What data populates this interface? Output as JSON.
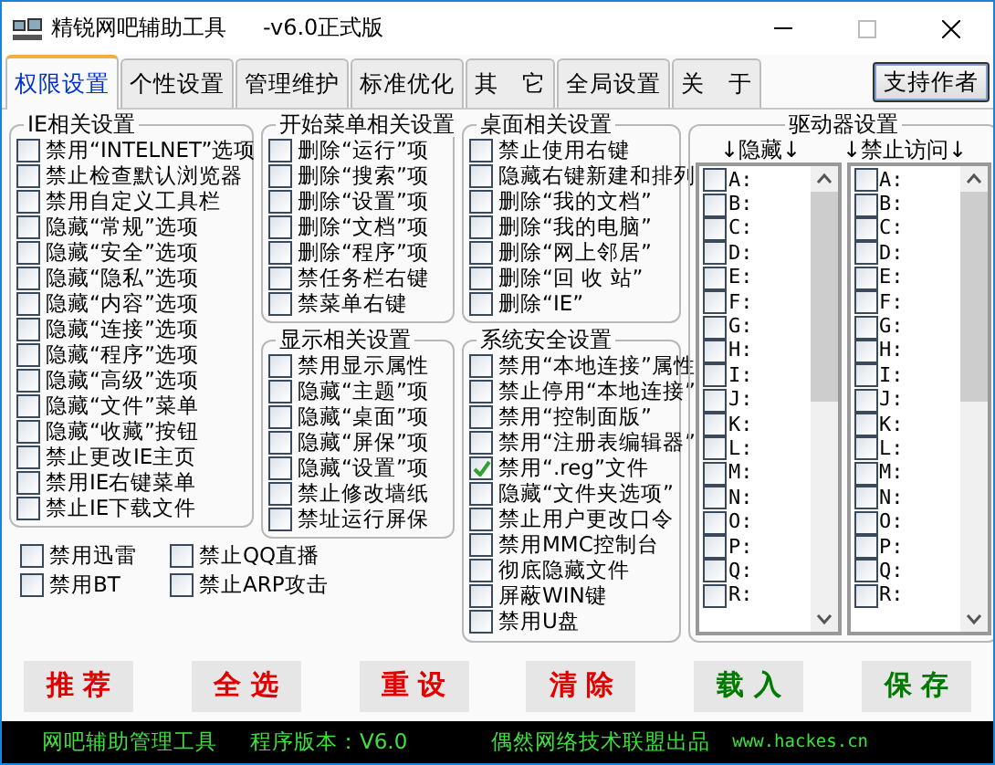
{
  "window": {
    "title": "精锐网吧辅助工具",
    "version": "-v6.0正式版"
  },
  "tabs": [
    {
      "label": "权限设置",
      "selected": true
    },
    {
      "label": "个性设置",
      "selected": false
    },
    {
      "label": "管理维护",
      "selected": false
    },
    {
      "label": "标准优化",
      "selected": false
    },
    {
      "label": "其　它",
      "selected": false
    },
    {
      "label": "全局设置",
      "selected": false
    },
    {
      "label": "关　于",
      "selected": false
    }
  ],
  "support_button": "支持作者",
  "ie_settings": {
    "title": "IE相关设置",
    "items": [
      {
        "label": "禁用“INTELNET”选项",
        "checked": false
      },
      {
        "label": "禁止检查默认浏览器",
        "checked": false
      },
      {
        "label": "禁用自定义工具栏",
        "checked": false
      },
      {
        "label": "隐藏“常规”选项",
        "checked": false
      },
      {
        "label": "隐藏“安全”选项",
        "checked": false
      },
      {
        "label": "隐藏“隐私”选项",
        "checked": false
      },
      {
        "label": "隐藏“内容”选项",
        "checked": false
      },
      {
        "label": "隐藏“连接”选项",
        "checked": false
      },
      {
        "label": "隐藏“程序”选项",
        "checked": false
      },
      {
        "label": "隐藏“高级”选项",
        "checked": false
      },
      {
        "label": "隐藏“文件”菜单",
        "checked": false
      },
      {
        "label": "隐藏“收藏”按钮",
        "checked": false
      },
      {
        "label": "禁止更改IE主页",
        "checked": false
      },
      {
        "label": "禁用IE右键菜单",
        "checked": false
      },
      {
        "label": "禁止IE下载文件",
        "checked": false
      }
    ]
  },
  "extra_options": [
    {
      "label": "禁用迅雷",
      "checked": false
    },
    {
      "label": "禁止QQ直播",
      "checked": false
    },
    {
      "label": "禁用BT",
      "checked": false
    },
    {
      "label": "禁止ARP攻击",
      "checked": false
    }
  ],
  "start_menu_settings": {
    "title": "开始菜单相关设置",
    "items": [
      {
        "label": "删除“运行”项",
        "checked": false
      },
      {
        "label": "删除“搜索”项",
        "checked": false
      },
      {
        "label": "删除“设置”项",
        "checked": false
      },
      {
        "label": "删除“文档”项",
        "checked": false
      },
      {
        "label": "删除“程序”项",
        "checked": false
      },
      {
        "label": "禁任务栏右键",
        "checked": false
      },
      {
        "label": "禁菜单右键",
        "checked": false
      }
    ]
  },
  "display_settings": {
    "title": "显示相关设置",
    "items": [
      {
        "label": "禁用显示属性",
        "checked": false
      },
      {
        "label": "隐藏“主题”项",
        "checked": false
      },
      {
        "label": "隐藏“桌面”项",
        "checked": false
      },
      {
        "label": "隐藏“屏保”项",
        "checked": false
      },
      {
        "label": "隐藏“设置”项",
        "checked": false
      },
      {
        "label": "禁止修改墙纸",
        "checked": false
      },
      {
        "label": "禁址运行屏保",
        "checked": false
      }
    ]
  },
  "desktop_settings": {
    "title": "桌面相关设置",
    "items": [
      {
        "label": "禁止使用右键",
        "checked": false
      },
      {
        "label": "隐藏右键新建和排列",
        "checked": false
      },
      {
        "label": "删除“我的文档”",
        "checked": false
      },
      {
        "label": "删除“我的电脑”",
        "checked": false
      },
      {
        "label": "删除“网上邻居”",
        "checked": false
      },
      {
        "label": "删除“回 收 站”",
        "checked": false
      },
      {
        "label": "删除“IE”",
        "checked": false
      }
    ]
  },
  "security_settings": {
    "title": "系统安全设置",
    "items": [
      {
        "label": "禁用“本地连接”属性",
        "checked": false
      },
      {
        "label": "禁止停用“本地连接”",
        "checked": false
      },
      {
        "label": "禁用“控制面版”",
        "checked": false
      },
      {
        "label": "禁用“注册表编辑器”",
        "checked": false
      },
      {
        "label": "禁用“.reg”文件",
        "checked": true
      },
      {
        "label": "隐藏“文件夹选项”",
        "checked": false
      },
      {
        "label": "禁止用户更改口令",
        "checked": false
      },
      {
        "label": "禁用MMC控制台",
        "checked": false
      },
      {
        "label": "彻底隐藏文件",
        "checked": false
      },
      {
        "label": "屏蔽WIN键",
        "checked": false
      },
      {
        "label": "禁用U盘",
        "checked": false
      }
    ]
  },
  "drive_settings": {
    "title": "驱动器设置",
    "hide_header": "↓隐藏↓",
    "deny_header": "↓禁止访问↓",
    "hide_drives": [
      {
        "label": "A:",
        "checked": false
      },
      {
        "label": "B:",
        "checked": false
      },
      {
        "label": "C:",
        "checked": false
      },
      {
        "label": "D:",
        "checked": false
      },
      {
        "label": "E:",
        "checked": false
      },
      {
        "label": "F:",
        "checked": false
      },
      {
        "label": "G:",
        "checked": false
      },
      {
        "label": "H:",
        "checked": false
      },
      {
        "label": "I:",
        "checked": false
      },
      {
        "label": "J:",
        "checked": false
      },
      {
        "label": "K:",
        "checked": false
      },
      {
        "label": "L:",
        "checked": false
      },
      {
        "label": "M:",
        "checked": false
      },
      {
        "label": "N:",
        "checked": false
      },
      {
        "label": "O:",
        "checked": false
      },
      {
        "label": "P:",
        "checked": false
      },
      {
        "label": "Q:",
        "checked": false
      },
      {
        "label": "R:",
        "checked": false
      }
    ],
    "deny_drives": [
      {
        "label": "A:",
        "checked": false
      },
      {
        "label": "B:",
        "checked": false
      },
      {
        "label": "C:",
        "checked": false
      },
      {
        "label": "D:",
        "checked": false
      },
      {
        "label": "E:",
        "checked": false
      },
      {
        "label": "F:",
        "checked": false
      },
      {
        "label": "G:",
        "checked": false
      },
      {
        "label": "H:",
        "checked": false
      },
      {
        "label": "I:",
        "checked": false
      },
      {
        "label": "J:",
        "checked": false
      },
      {
        "label": "K:",
        "checked": false
      },
      {
        "label": "L:",
        "checked": false
      },
      {
        "label": "M:",
        "checked": false
      },
      {
        "label": "N:",
        "checked": false
      },
      {
        "label": "O:",
        "checked": false
      },
      {
        "label": "P:",
        "checked": false
      },
      {
        "label": "Q:",
        "checked": false
      },
      {
        "label": "R:",
        "checked": false
      }
    ]
  },
  "buttons": [
    {
      "label": "推 荐",
      "color": "#e00000"
    },
    {
      "label": "全 选",
      "color": "#e00000"
    },
    {
      "label": "重 设",
      "color": "#e00000"
    },
    {
      "label": "清 除",
      "color": "#e00000"
    },
    {
      "label": "载 入",
      "color": "#007a00"
    },
    {
      "label": "保 存",
      "color": "#007a00"
    }
  ],
  "status_bar": [
    "网吧辅助管理工具",
    "程序版本：V6.0",
    "偶然网络技术联盟出品",
    "www.hackes.cn"
  ]
}
